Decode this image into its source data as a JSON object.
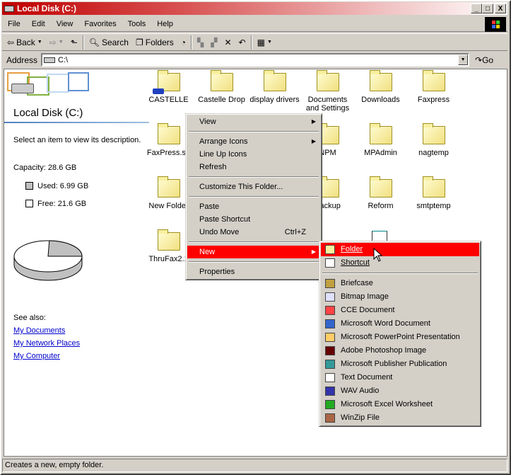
{
  "window": {
    "title": "Local Disk (C:)",
    "min": "_",
    "max": "□",
    "close": "X"
  },
  "menubar": [
    "File",
    "Edit",
    "View",
    "Favorites",
    "Tools",
    "Help"
  ],
  "toolbar": {
    "back": "Back",
    "search": "Search",
    "folders": "Folders"
  },
  "address": {
    "label": "Address",
    "value": "C:\\",
    "go": "Go"
  },
  "left": {
    "title": "Local Disk (C:)",
    "description": "Select an item to view its description.",
    "capacity": "Capacity: 28.6 GB",
    "used": "Used: 6.99 GB",
    "free": "Free: 21.6 GB",
    "used_fraction": 0.244,
    "see_also": "See also:",
    "links": [
      "My Documents",
      "My Network Places",
      "My Computer"
    ]
  },
  "icons": [
    {
      "label": "CASTELLE",
      "shared": true
    },
    {
      "label": "Castelle Drop"
    },
    {
      "label": "display drivers"
    },
    {
      "label": "Documents and Settings"
    },
    {
      "label": "Downloads"
    },
    {
      "label": "Faxpress"
    },
    {
      "label": "FaxPress.sp"
    },
    {
      "label": ""
    },
    {
      "label": ""
    },
    {
      "label": "NPM"
    },
    {
      "label": "MPAdmin"
    },
    {
      "label": "nagtemp"
    },
    {
      "label": "New Folder"
    },
    {
      "label": ""
    },
    {
      "label": ""
    },
    {
      "label": "Backup"
    },
    {
      "label": "Reform"
    },
    {
      "label": "smtptemp"
    },
    {
      "label": "ThruFax2.1"
    }
  ],
  "context_menu": {
    "items": [
      "View",
      "Arrange Icons",
      "Line Up Icons",
      "Refresh",
      "Customize This Folder...",
      "Paste",
      "Paste Shortcut",
      "Undo Move",
      "New",
      "Properties"
    ],
    "undo_shortcut": "Ctrl+Z"
  },
  "new_submenu": {
    "items": [
      "Folder",
      "Shortcut",
      "Briefcase",
      "Bitmap Image",
      "CCE Document",
      "Microsoft Word Document",
      "Microsoft PowerPoint Presentation",
      "Adobe Photoshop Image",
      "Microsoft Publisher Publication",
      "Text Document",
      "WAV Audio",
      "Microsoft Excel Worksheet",
      "WinZip File"
    ]
  },
  "status": "Creates a new, empty folder.",
  "colors": {
    "highlight": "#ff0000",
    "title_start": "#c00000"
  }
}
